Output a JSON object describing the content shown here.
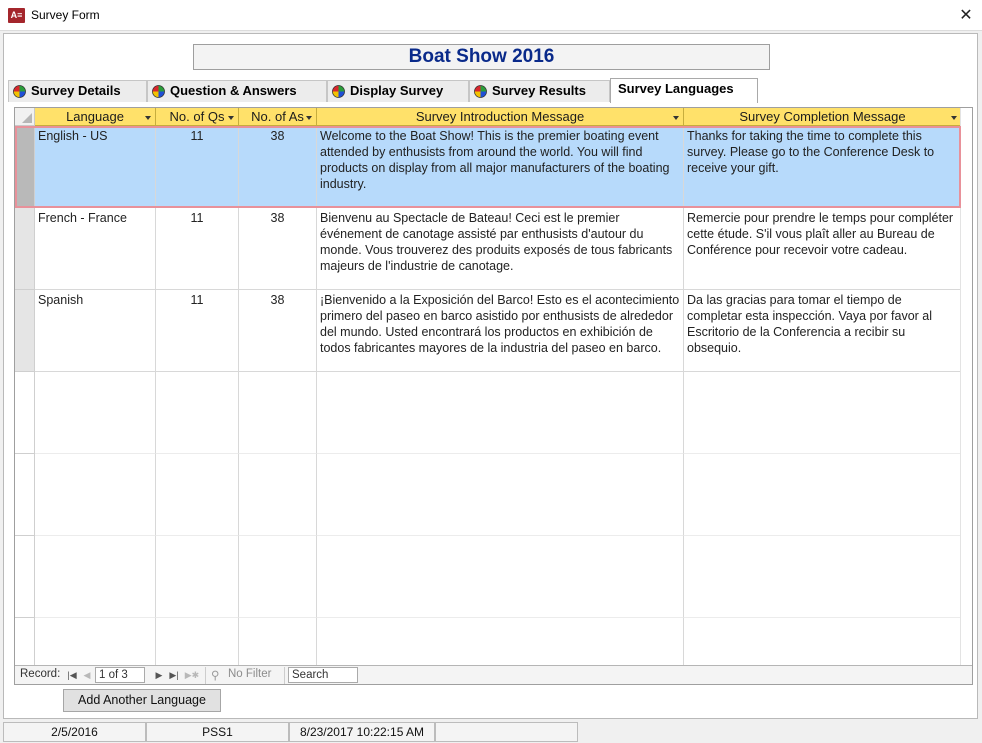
{
  "window": {
    "app_icon_text": "A≡",
    "title": "Survey Form",
    "close_glyph": "✕"
  },
  "header": {
    "title": "Boat Show 2016"
  },
  "tabs": [
    {
      "label": "Survey Details",
      "icon": "tab-ball-icon",
      "active": false
    },
    {
      "label": "Question & Answers",
      "icon": "tab-ball-icon",
      "active": false
    },
    {
      "label": "Display Survey",
      "icon": "tab-ball-icon",
      "active": false
    },
    {
      "label": "Survey Results",
      "icon": "tab-ball-icon",
      "active": false
    },
    {
      "label": "Survey Languages",
      "icon": null,
      "active": true
    }
  ],
  "grid": {
    "columns": [
      {
        "label": "Language"
      },
      {
        "label": "No. of Qs"
      },
      {
        "label": "No. of As"
      },
      {
        "label": "Survey Introduction Message"
      },
      {
        "label": "Survey Completion Message"
      }
    ],
    "rows": [
      {
        "language": "English - US",
        "qs": "11",
        "as": "38",
        "intro": "Welcome to the Boat Show! This is the premier boating event attended by enthusists from around the world. You will find products on display from all major manufacturers of the boating industry.",
        "completion": "Thanks for taking the time to complete this survey. Please go to the Conference Desk to receive your gift.",
        "selected": true
      },
      {
        "language": "French - France",
        "qs": "11",
        "as": "38",
        "intro": "Bienvenu au Spectacle de Bateau! Ceci est le premier événement de canotage assisté par enthusists d'autour du monde. Vous trouverez des produits exposés de tous fabricants majeurs de l'industrie de canotage.",
        "completion": "Remercie pour prendre le temps pour compléter cette étude. S'il vous plaît aller au Bureau de Conférence pour recevoir votre cadeau.",
        "selected": false
      },
      {
        "language": "Spanish",
        "qs": "11",
        "as": "38",
        "intro": "¡Bienvenido a la Exposición del Barco! Esto es el acontecimiento primero del paseo en barco asistido por enthusists de alrededor del mundo. Usted encontrará los productos en exhibición de todos fabricantes mayores de la industria del paseo en barco.",
        "completion": "Da las gracias para tomar el tiempo de completar esta inspección. Vaya por favor al Escritorio de la Conferencia a recibir su obsequio.",
        "selected": false
      }
    ],
    "colors": {
      "header_bg": "#ffe16a",
      "selected_row_bg": "#b7dafb",
      "selected_row_border": "#e8919a"
    }
  },
  "navigator": {
    "record_label": "Record:",
    "record_value": "1 of 3",
    "first_glyph": "|◀",
    "prev_glyph": "◀",
    "next_glyph": "▶",
    "last_glyph": "▶|",
    "new_glyph": "▶✱",
    "filter_glyph": "⚲",
    "filter_text": "No Filter",
    "search_value": "Search"
  },
  "actions": {
    "add_language_label": "Add Another Language"
  },
  "statusbar": {
    "date": "2/5/2016",
    "code": "PSS1",
    "timestamp": "8/23/2017 10:22:15 AM"
  }
}
